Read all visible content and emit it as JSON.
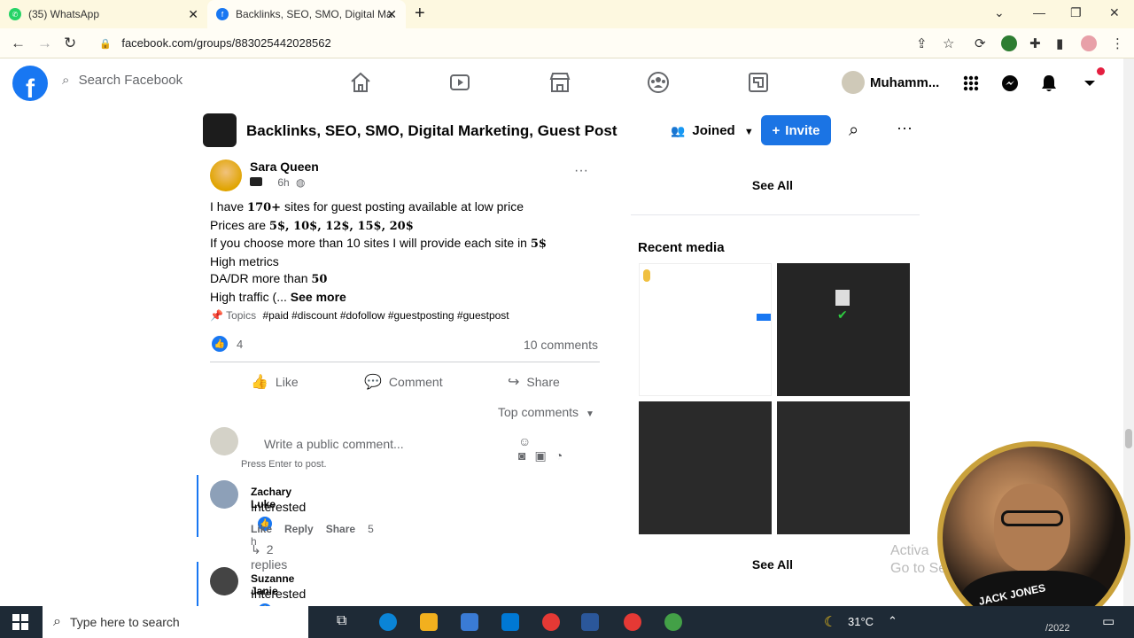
{
  "browser": {
    "tabs": [
      {
        "title": "(35) WhatsApp",
        "icon": "whatsapp-icon",
        "color": "#25d366",
        "active": false
      },
      {
        "title": "Backlinks, SEO, SMO, Digital Ma",
        "icon": "facebook-icon",
        "color": "#1877f2",
        "active": true
      }
    ],
    "new_tab": "+",
    "url": "facebook.com/groups/883025442028562"
  },
  "fb": {
    "search_placeholder": "Search Facebook",
    "profile_name": "Muhamm...",
    "brand_color": "#1877f2"
  },
  "group": {
    "name": "Backlinks, SEO, SMO, Digital Marketing, Guest Post",
    "joined_label": "Joined",
    "invite_label": "Invite"
  },
  "post": {
    "author": "Sara Queen",
    "time": "6h",
    "lines": [
      [
        "I have ",
        "170+",
        " sites for guest posting available at low price"
      ],
      [
        "Prices are ",
        "5$, 10$, 12$, 15$, 20$",
        ""
      ],
      [
        "If you choose more than 10 sites I will provide each site in ",
        "5$",
        ""
      ],
      [
        "High metrics",
        "",
        ""
      ],
      [
        "DA/DR more than ",
        "50",
        ""
      ],
      [
        "High traffic (... ",
        "",
        ""
      ]
    ],
    "see_more": "See more",
    "topics_label": "Topics",
    "topics": "#paid #discount #dofollow #guestposting #guestpost",
    "reaction_count": "4",
    "comment_count": "10 comments",
    "actions": {
      "like": "Like",
      "comment": "Comment",
      "share": "Share"
    },
    "sort_label": "Top comments",
    "comment_placeholder": "Write a public comment...",
    "press_enter": "Press Enter to post.",
    "comments": [
      {
        "author": "Zachary Luke",
        "text": "Interested",
        "like": "Like",
        "reply": "Reply",
        "share": "Share",
        "time": "5 h",
        "replies": "2 replies"
      },
      {
        "author": "Suzanne Janie",
        "text": "Interested"
      }
    ]
  },
  "sidebar": {
    "see_all_top": "See All",
    "recent_media_title": "Recent media",
    "see_all_bottom": "See All",
    "watermark": "Activa\nGo to Se"
  },
  "webcam": {
    "label": "JACK JONES"
  },
  "taskbar": {
    "search_placeholder": "Type here to search",
    "temperature": "31°C",
    "date": "/2022"
  }
}
